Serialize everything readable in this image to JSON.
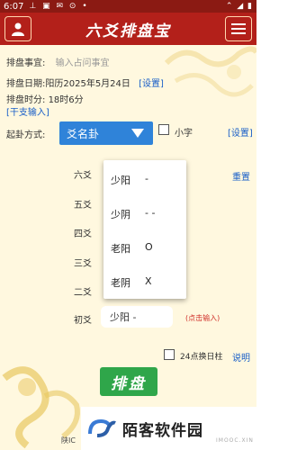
{
  "status": {
    "time": "6:07",
    "icons": "⊥ ▣ ✉ ⊙ •",
    "right": "⌃ ◢ ▮"
  },
  "appbar": {
    "title": "六爻排盘宝",
    "user_icon": "user-icon",
    "menu_icon": "menu-icon"
  },
  "form": {
    "matter_label": "排盘事宜:",
    "matter_placeholder": "输入占问事宜",
    "date_label": "排盘日期:",
    "date_value": "阳历2025年5月24日",
    "date_link": "[设置]",
    "time_label": "排盘时分:",
    "time_value": "18时6分",
    "ganzhi_link": "[干支输入]",
    "method_label": "起卦方式:",
    "method_selected": "爻名卦",
    "small_char_label": "小字",
    "method_settings_link": "[设置]",
    "reset_link": "重置",
    "yao_labels": [
      "六爻",
      "五爻",
      "四爻",
      "三爻",
      "二爻",
      "初爻"
    ],
    "chu_yao_value": "少阳  -",
    "click_input_hint": "(点击输入)",
    "day_pillar_label": "24点换日柱",
    "explain_link": "说明",
    "submit_label": "排盘"
  },
  "dropdown": {
    "options": [
      {
        "name": "少阳",
        "symbol": "-"
      },
      {
        "name": "少阴",
        "symbol": "- -"
      },
      {
        "name": "老阳",
        "symbol": "O"
      },
      {
        "name": "老阴",
        "symbol": "X"
      }
    ]
  },
  "watermark": {
    "text": "陌客软件园",
    "sub": "IMOOC.XIN"
  },
  "footer": {
    "text": "陕IC"
  },
  "colors": {
    "header": "#b3201a",
    "select": "#2f83d9",
    "button": "#2fa64a",
    "link": "#1a5fc8"
  }
}
